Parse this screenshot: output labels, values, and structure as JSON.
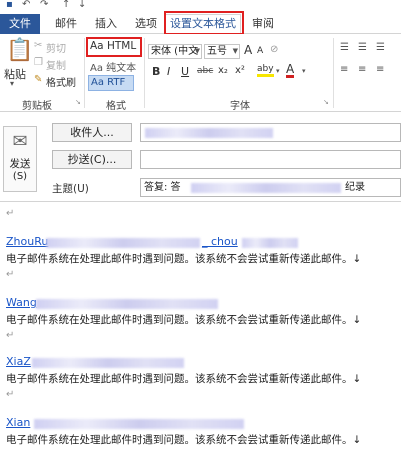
{
  "qat": {
    "save_icon": "save-icon",
    "undo_icon": "undo-icon",
    "redo_icon": "redo-icon",
    "up_icon": "up-icon",
    "down_icon": "down-icon"
  },
  "tabs": [
    {
      "label": "文件"
    },
    {
      "label": "邮件"
    },
    {
      "label": "插入"
    },
    {
      "label": "选项"
    },
    {
      "label": "设置文本格式"
    },
    {
      "label": "审阅"
    }
  ],
  "ribbon": {
    "clipboard": {
      "paste": "粘贴",
      "cut": "剪切",
      "copy": "复制",
      "format_painter": "格式刷",
      "label": "剪贴板"
    },
    "format": {
      "html": "Aa HTML",
      "plain": "Aa 纯文本",
      "rtf": "Aa RTF",
      "label": "格式"
    },
    "font": {
      "name": "宋体 (中文",
      "size": "五号",
      "grow": "A",
      "shrink": "A",
      "bold": "B",
      "italic": "I",
      "underline": "U",
      "strike": "abc",
      "subscript": "x₂",
      "superscript": "x²",
      "highlight": "aby",
      "font_color": "A",
      "label": "字体"
    }
  },
  "header": {
    "send": "发送",
    "send_shortcut": "(S)",
    "to_button": "收件人...",
    "cc_button": "抄送(C)...",
    "subject_label": "主题(U)",
    "subject_prefix": "答复: 答",
    "subject_suffix": "纪录"
  },
  "body": {
    "mark": "↵",
    "entries": [
      {
        "name_start": "ZhouRu",
        "name_mid": "_ chou",
        "message": "电子邮件系统在处理此邮件时遇到问题。该系统不会尝试重新传递此邮件。↓"
      },
      {
        "name_start": "Wang",
        "name_mid": "",
        "message": "电子邮件系统在处理此邮件时遇到问题。该系统不会尝试重新传递此邮件。↓"
      },
      {
        "name_start": "XiaZ",
        "name_mid": "",
        "message": "电子邮件系统在处理此邮件时遇到问题。该系统不会尝试重新传递此邮件。↓"
      },
      {
        "name_start": "Xian",
        "name_mid": "",
        "message": "电子邮件系统在处理此邮件时遇到问题。该系统不会尝试重新传递此邮件。↓"
      }
    ]
  },
  "colors": {
    "file_tab": "#2b579a",
    "highlight_box": "#e02020",
    "link": "#1a55c8",
    "font_red": "#d02020",
    "highlight_yellow": "#f7e600"
  }
}
